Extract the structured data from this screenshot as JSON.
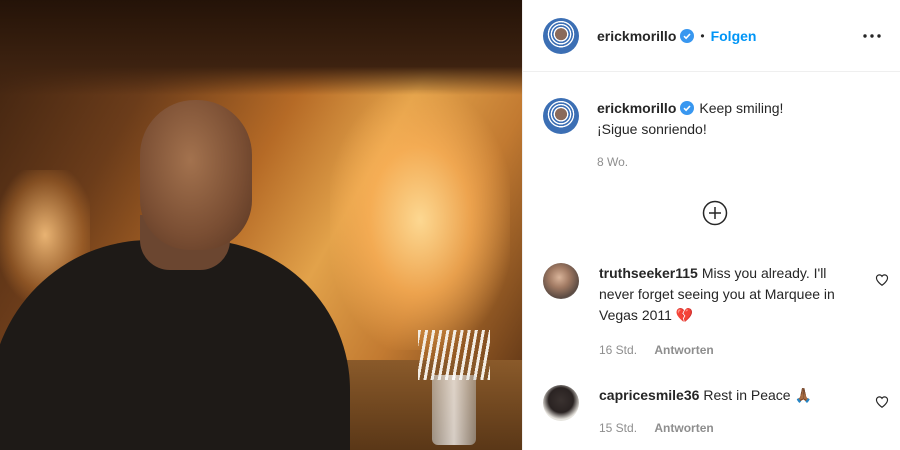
{
  "post": {
    "username": "erickmorillo",
    "follow_label": "Folgen",
    "dot": "•",
    "caption_line1": "Keep smiling!",
    "caption_line2": "¡Sigue sonriendo!",
    "time_ago": "8 Wo."
  },
  "comments": [
    {
      "username": "truthseeker115",
      "text": "Miss you already. I'll never forget seeing you at Marquee in Vegas 2011",
      "emoji": "💔",
      "time": "16 Std.",
      "reply_label": "Antworten"
    },
    {
      "username": "capricesmile36",
      "text": "Rest in Peace",
      "emoji": "🙏🏾",
      "time": "15 Std.",
      "reply_label": "Antworten"
    }
  ],
  "icons": {
    "verified": "verified-badge-icon",
    "more": "more-options-icon",
    "plus": "load-more-comments-icon",
    "heart": "like-heart-icon"
  },
  "colors": {
    "link_blue": "#0095f6",
    "muted": "#8e8e8e",
    "text": "#262626",
    "heart_red": "#c4303c"
  }
}
